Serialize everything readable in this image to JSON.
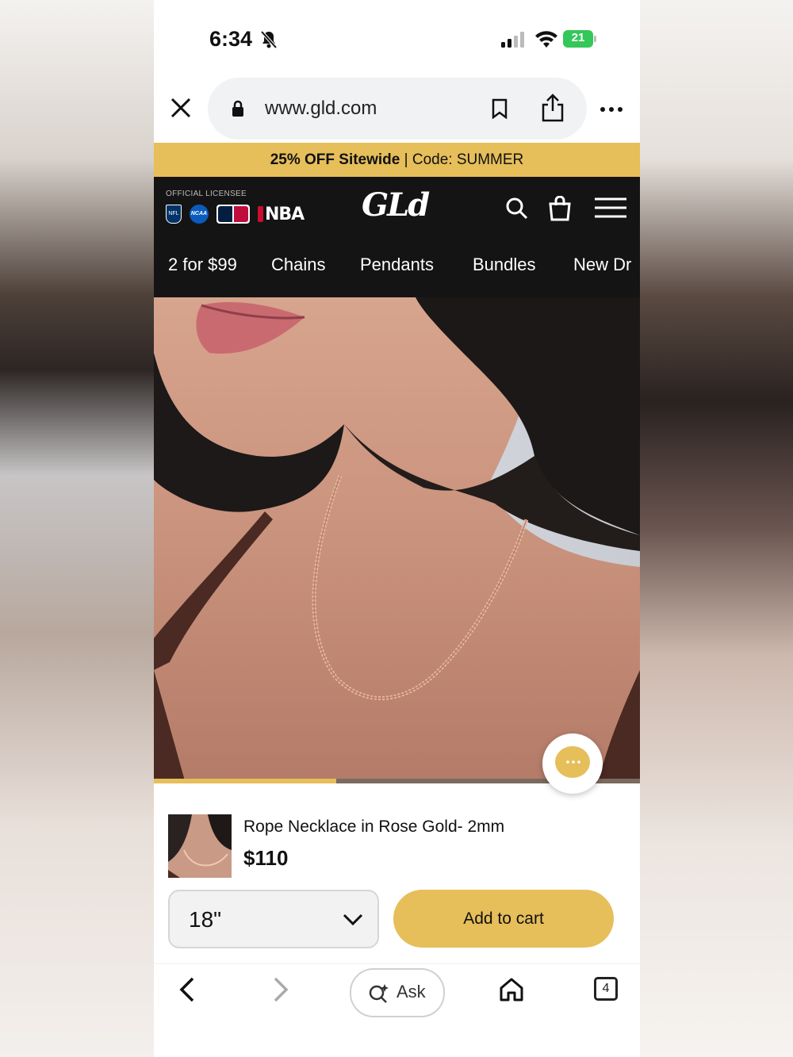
{
  "status_bar": {
    "time": "6:34",
    "battery": "21"
  },
  "browser": {
    "url": "www.gld.com",
    "open_tabs": "4",
    "ask_label": "Ask"
  },
  "promo": {
    "bold": "25% OFF Sitewide",
    "rest": " | Code: SUMMER"
  },
  "header": {
    "licensee_label": "OFFICIAL LICENSEE",
    "leagues": {
      "nfl": "NFL",
      "ncaa": "NCAA",
      "nba": "NBA"
    },
    "logo": "GLd",
    "nav": [
      "2 for $99",
      "Chains",
      "Pendants",
      "Bundles",
      "New Dr"
    ]
  },
  "gallery": {
    "progress_fraction": 0.375
  },
  "product": {
    "name": "Rope Necklace in Rose Gold- 2mm",
    "price": "$110",
    "size": "18\"",
    "add_to_cart": "Add to cart"
  },
  "colors": {
    "accent": "#e6be5a",
    "header_bg": "#151414"
  }
}
